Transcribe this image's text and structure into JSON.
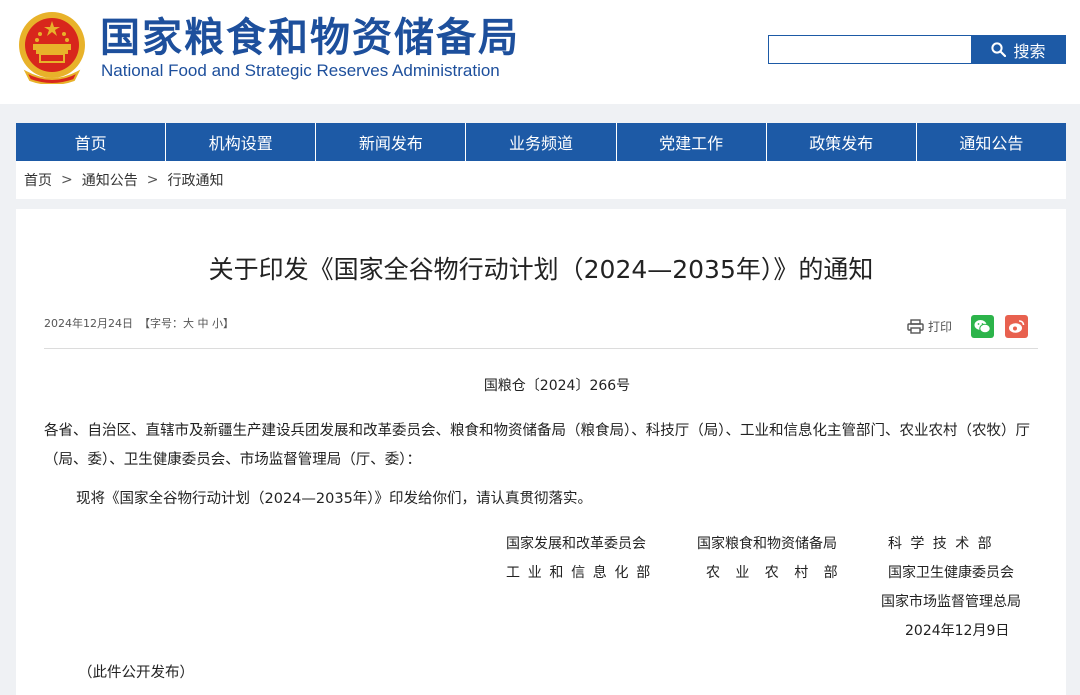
{
  "header": {
    "site_name_cn": "国家粮食和物资储备局",
    "site_name_en": "National Food and Strategic Reserves Administration"
  },
  "search": {
    "placeholder": "",
    "button_label": "搜索"
  },
  "nav": {
    "items": [
      {
        "label": "首页"
      },
      {
        "label": "机构设置"
      },
      {
        "label": "新闻发布"
      },
      {
        "label": "业务频道"
      },
      {
        "label": "党建工作"
      },
      {
        "label": "政策发布"
      },
      {
        "label": "通知公告"
      }
    ]
  },
  "breadcrumb": {
    "items": [
      "首页",
      "通知公告",
      "行政通知"
    ],
    "separator": ">"
  },
  "article": {
    "title": "关于印发《国家全谷物行动计划（2024—2035年）》的通知",
    "date": "2024年12月24日",
    "font_size_label": "【字号：",
    "font_size_large": "大",
    "font_size_medium": "中",
    "font_size_small": "小",
    "font_size_end": "】",
    "print_label": "打印",
    "doc_number": "国粮仓〔2024〕266号",
    "recipients": "各省、自治区、直辖市及新疆生产建设兵团发展和改革委员会、粮食和物资储备局（粮食局）、科技厅（局）、工业和信息化主管部门、农业农村（农牧）厅（局、委）、卫生健康委员会、市场监督管理局（厅、委）：",
    "body": "现将《国家全谷物行动计划（2024—2035年）》印发给你们，请认真贯彻落实。",
    "signatures": {
      "sig_1": "国家发展和改革委员会",
      "sig_2": "国家粮食和物资储备局",
      "sig_3": "科学技术部",
      "sig_4": "工业和信息化部",
      "sig_5": "农业农村部",
      "sig_6": "国家卫生健康委员会",
      "sig_7": "国家市场监督管理总局"
    },
    "sign_date": "2024年12月9日",
    "footnote": "（此件公开发布）"
  },
  "colors": {
    "brand_blue": "#1d5aa6",
    "title_blue": "#1d4f9c",
    "wechat_green": "#2cb44a",
    "weibo_red": "#e8614f"
  },
  "icons": {
    "emblem": "national-emblem-icon",
    "search": "search-icon",
    "print": "printer-icon",
    "wechat": "wechat-icon",
    "weibo": "weibo-icon"
  }
}
